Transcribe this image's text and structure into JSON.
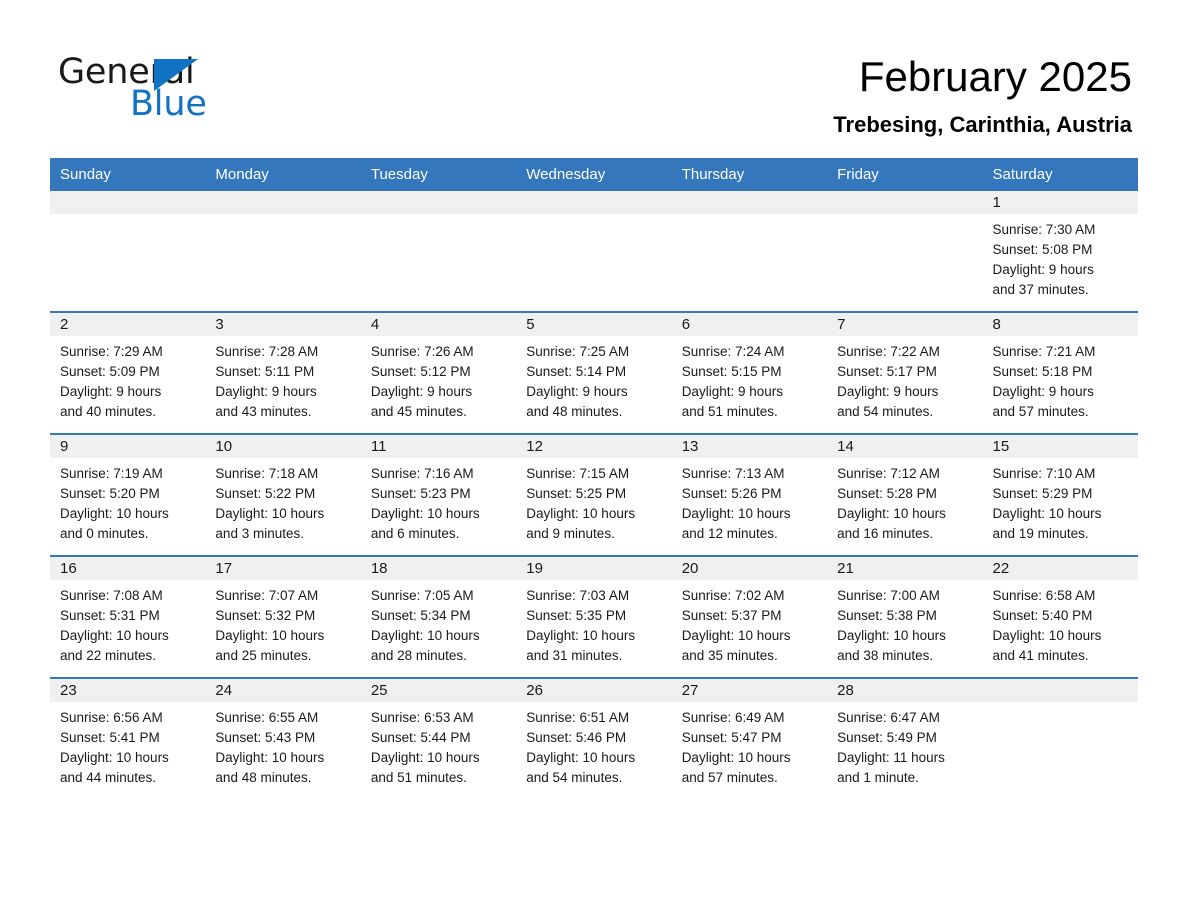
{
  "brand": {
    "name_part1": "General",
    "name_part2": "Blue",
    "triangle_color": "#1273c4"
  },
  "header": {
    "month_title": "February 2025",
    "location": "Trebesing, Carinthia, Austria"
  },
  "theme": {
    "header_blue": "#3477bc",
    "daynum_band": "#f0f0f0",
    "text": "#1a1a1a"
  },
  "weekday_headers": [
    "Sunday",
    "Monday",
    "Tuesday",
    "Wednesday",
    "Thursday",
    "Friday",
    "Saturday"
  ],
  "weeks": [
    [
      {
        "day": "",
        "empty": true,
        "sunrise": "",
        "sunset": "",
        "daylight_line1": "",
        "daylight_line2": ""
      },
      {
        "day": "",
        "empty": true,
        "sunrise": "",
        "sunset": "",
        "daylight_line1": "",
        "daylight_line2": ""
      },
      {
        "day": "",
        "empty": true,
        "sunrise": "",
        "sunset": "",
        "daylight_line1": "",
        "daylight_line2": ""
      },
      {
        "day": "",
        "empty": true,
        "sunrise": "",
        "sunset": "",
        "daylight_line1": "",
        "daylight_line2": ""
      },
      {
        "day": "",
        "empty": true,
        "sunrise": "",
        "sunset": "",
        "daylight_line1": "",
        "daylight_line2": ""
      },
      {
        "day": "",
        "empty": true,
        "sunrise": "",
        "sunset": "",
        "daylight_line1": "",
        "daylight_line2": ""
      },
      {
        "day": "1",
        "empty": false,
        "sunrise": "Sunrise: 7:30 AM",
        "sunset": "Sunset: 5:08 PM",
        "daylight_line1": "Daylight: 9 hours",
        "daylight_line2": "and 37 minutes."
      }
    ],
    [
      {
        "day": "2",
        "empty": false,
        "sunrise": "Sunrise: 7:29 AM",
        "sunset": "Sunset: 5:09 PM",
        "daylight_line1": "Daylight: 9 hours",
        "daylight_line2": "and 40 minutes."
      },
      {
        "day": "3",
        "empty": false,
        "sunrise": "Sunrise: 7:28 AM",
        "sunset": "Sunset: 5:11 PM",
        "daylight_line1": "Daylight: 9 hours",
        "daylight_line2": "and 43 minutes."
      },
      {
        "day": "4",
        "empty": false,
        "sunrise": "Sunrise: 7:26 AM",
        "sunset": "Sunset: 5:12 PM",
        "daylight_line1": "Daylight: 9 hours",
        "daylight_line2": "and 45 minutes."
      },
      {
        "day": "5",
        "empty": false,
        "sunrise": "Sunrise: 7:25 AM",
        "sunset": "Sunset: 5:14 PM",
        "daylight_line1": "Daylight: 9 hours",
        "daylight_line2": "and 48 minutes."
      },
      {
        "day": "6",
        "empty": false,
        "sunrise": "Sunrise: 7:24 AM",
        "sunset": "Sunset: 5:15 PM",
        "daylight_line1": "Daylight: 9 hours",
        "daylight_line2": "and 51 minutes."
      },
      {
        "day": "7",
        "empty": false,
        "sunrise": "Sunrise: 7:22 AM",
        "sunset": "Sunset: 5:17 PM",
        "daylight_line1": "Daylight: 9 hours",
        "daylight_line2": "and 54 minutes."
      },
      {
        "day": "8",
        "empty": false,
        "sunrise": "Sunrise: 7:21 AM",
        "sunset": "Sunset: 5:18 PM",
        "daylight_line1": "Daylight: 9 hours",
        "daylight_line2": "and 57 minutes."
      }
    ],
    [
      {
        "day": "9",
        "empty": false,
        "sunrise": "Sunrise: 7:19 AM",
        "sunset": "Sunset: 5:20 PM",
        "daylight_line1": "Daylight: 10 hours",
        "daylight_line2": "and 0 minutes."
      },
      {
        "day": "10",
        "empty": false,
        "sunrise": "Sunrise: 7:18 AM",
        "sunset": "Sunset: 5:22 PM",
        "daylight_line1": "Daylight: 10 hours",
        "daylight_line2": "and 3 minutes."
      },
      {
        "day": "11",
        "empty": false,
        "sunrise": "Sunrise: 7:16 AM",
        "sunset": "Sunset: 5:23 PM",
        "daylight_line1": "Daylight: 10 hours",
        "daylight_line2": "and 6 minutes."
      },
      {
        "day": "12",
        "empty": false,
        "sunrise": "Sunrise: 7:15 AM",
        "sunset": "Sunset: 5:25 PM",
        "daylight_line1": "Daylight: 10 hours",
        "daylight_line2": "and 9 minutes."
      },
      {
        "day": "13",
        "empty": false,
        "sunrise": "Sunrise: 7:13 AM",
        "sunset": "Sunset: 5:26 PM",
        "daylight_line1": "Daylight: 10 hours",
        "daylight_line2": "and 12 minutes."
      },
      {
        "day": "14",
        "empty": false,
        "sunrise": "Sunrise: 7:12 AM",
        "sunset": "Sunset: 5:28 PM",
        "daylight_line1": "Daylight: 10 hours",
        "daylight_line2": "and 16 minutes."
      },
      {
        "day": "15",
        "empty": false,
        "sunrise": "Sunrise: 7:10 AM",
        "sunset": "Sunset: 5:29 PM",
        "daylight_line1": "Daylight: 10 hours",
        "daylight_line2": "and 19 minutes."
      }
    ],
    [
      {
        "day": "16",
        "empty": false,
        "sunrise": "Sunrise: 7:08 AM",
        "sunset": "Sunset: 5:31 PM",
        "daylight_line1": "Daylight: 10 hours",
        "daylight_line2": "and 22 minutes."
      },
      {
        "day": "17",
        "empty": false,
        "sunrise": "Sunrise: 7:07 AM",
        "sunset": "Sunset: 5:32 PM",
        "daylight_line1": "Daylight: 10 hours",
        "daylight_line2": "and 25 minutes."
      },
      {
        "day": "18",
        "empty": false,
        "sunrise": "Sunrise: 7:05 AM",
        "sunset": "Sunset: 5:34 PM",
        "daylight_line1": "Daylight: 10 hours",
        "daylight_line2": "and 28 minutes."
      },
      {
        "day": "19",
        "empty": false,
        "sunrise": "Sunrise: 7:03 AM",
        "sunset": "Sunset: 5:35 PM",
        "daylight_line1": "Daylight: 10 hours",
        "daylight_line2": "and 31 minutes."
      },
      {
        "day": "20",
        "empty": false,
        "sunrise": "Sunrise: 7:02 AM",
        "sunset": "Sunset: 5:37 PM",
        "daylight_line1": "Daylight: 10 hours",
        "daylight_line2": "and 35 minutes."
      },
      {
        "day": "21",
        "empty": false,
        "sunrise": "Sunrise: 7:00 AM",
        "sunset": "Sunset: 5:38 PM",
        "daylight_line1": "Daylight: 10 hours",
        "daylight_line2": "and 38 minutes."
      },
      {
        "day": "22",
        "empty": false,
        "sunrise": "Sunrise: 6:58 AM",
        "sunset": "Sunset: 5:40 PM",
        "daylight_line1": "Daylight: 10 hours",
        "daylight_line2": "and 41 minutes."
      }
    ],
    [
      {
        "day": "23",
        "empty": false,
        "sunrise": "Sunrise: 6:56 AM",
        "sunset": "Sunset: 5:41 PM",
        "daylight_line1": "Daylight: 10 hours",
        "daylight_line2": "and 44 minutes."
      },
      {
        "day": "24",
        "empty": false,
        "sunrise": "Sunrise: 6:55 AM",
        "sunset": "Sunset: 5:43 PM",
        "daylight_line1": "Daylight: 10 hours",
        "daylight_line2": "and 48 minutes."
      },
      {
        "day": "25",
        "empty": false,
        "sunrise": "Sunrise: 6:53 AM",
        "sunset": "Sunset: 5:44 PM",
        "daylight_line1": "Daylight: 10 hours",
        "daylight_line2": "and 51 minutes."
      },
      {
        "day": "26",
        "empty": false,
        "sunrise": "Sunrise: 6:51 AM",
        "sunset": "Sunset: 5:46 PM",
        "daylight_line1": "Daylight: 10 hours",
        "daylight_line2": "and 54 minutes."
      },
      {
        "day": "27",
        "empty": false,
        "sunrise": "Sunrise: 6:49 AM",
        "sunset": "Sunset: 5:47 PM",
        "daylight_line1": "Daylight: 10 hours",
        "daylight_line2": "and 57 minutes."
      },
      {
        "day": "28",
        "empty": false,
        "sunrise": "Sunrise: 6:47 AM",
        "sunset": "Sunset: 5:49 PM",
        "daylight_line1": "Daylight: 11 hours",
        "daylight_line2": "and 1 minute."
      },
      {
        "day": "",
        "empty": true,
        "sunrise": "",
        "sunset": "",
        "daylight_line1": "",
        "daylight_line2": ""
      }
    ]
  ]
}
